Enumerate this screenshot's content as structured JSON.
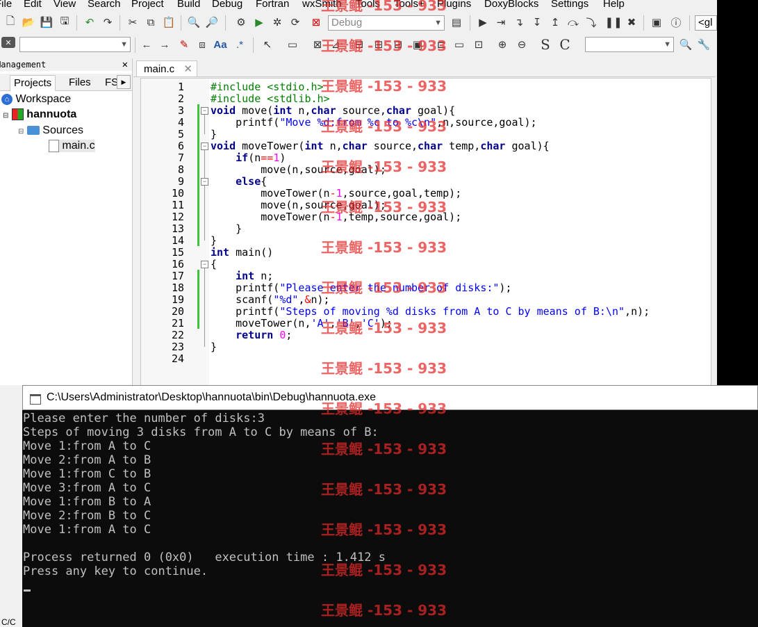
{
  "menu": [
    "File",
    "Edit",
    "View",
    "Search",
    "Project",
    "Build",
    "Debug",
    "Fortran",
    "wxSmith",
    "Tools",
    "Tools+",
    "Plugins",
    "DoxyBlocks",
    "Settings",
    "Help"
  ],
  "toolbar": {
    "build_target": "Debug",
    "right_combo": "<gl"
  },
  "management": {
    "title": "Management",
    "tabs": [
      "Projects",
      "Files",
      "FS"
    ],
    "workspace": "Workspace",
    "project": "hannuota",
    "folder": "Sources",
    "file": "main.c"
  },
  "editor": {
    "tab": "main.c",
    "lines": [
      {
        "n": "1",
        "html": "<span class='pp'>#include &lt;stdio.h&gt;</span>"
      },
      {
        "n": "2",
        "html": "<span class='pp'>#include &lt;stdlib.h&gt;</span>"
      },
      {
        "n": "3",
        "html": "<span class='kw'>void</span> move(<span class='kw'>int</span> n,<span class='kw'>char</span> source,<span class='kw'>char</span> goal){"
      },
      {
        "n": "4",
        "html": "    printf(<span class='st'>\"Move %d:from %c to %c\\n\"</span>,n,source,goal);"
      },
      {
        "n": "5",
        "html": "}"
      },
      {
        "n": "6",
        "html": "<span class='kw'>void</span> moveTower(<span class='kw'>int</span> n,<span class='kw'>char</span> source,<span class='kw'>char</span> temp,<span class='kw'>char</span> goal){"
      },
      {
        "n": "7",
        "html": "    <span class='kw'>if</span>(n<span class='op'>==</span><span class='nm'>1</span>)"
      },
      {
        "n": "8",
        "html": "        move(n,source,goal);"
      },
      {
        "n": "9",
        "html": "    <span class='kw'>else</span>{"
      },
      {
        "n": "10",
        "html": "        moveTower(n<span class='op'>-</span><span class='nm'>1</span>,source,goal,temp);"
      },
      {
        "n": "11",
        "html": "        move(n,source,goal);"
      },
      {
        "n": "12",
        "html": "        moveTower(n<span class='op'>-</span><span class='nm'>1</span>,temp,source,goal);"
      },
      {
        "n": "13",
        "html": "    }"
      },
      {
        "n": "14",
        "html": "}"
      },
      {
        "n": "15",
        "html": "<span class='kw'>int</span> main()"
      },
      {
        "n": "16",
        "html": "{"
      },
      {
        "n": "17",
        "html": "    <span class='kw'>int</span> n;"
      },
      {
        "n": "18",
        "html": "    printf(<span class='st'>\"Please enter the number of disks:\"</span>);"
      },
      {
        "n": "19",
        "html": "    scanf(<span class='st'>\"%d\"</span>,<span class='op'>&amp;</span>n);"
      },
      {
        "n": "20",
        "html": "    printf(<span class='st'>\"Steps of moving %d disks from A to C by means of B:\\n\"</span>,n);"
      },
      {
        "n": "21",
        "html": "    moveTower(n,<span class='st'>'A'</span>,<span class='st'>'B'</span>,<span class='st'>'C'</span>);"
      },
      {
        "n": "22",
        "html": "    <span class='kw'>return</span> <span class='nm'>0</span>;"
      },
      {
        "n": "23",
        "html": "}"
      },
      {
        "n": "24",
        "html": ""
      }
    ]
  },
  "console": {
    "title": "C:\\Users\\Administrator\\Desktop\\hannuota\\bin\\Debug\\hannuota.exe",
    "lines": [
      "Please enter the number of disks:3",
      "Steps of moving 3 disks from A to C by means of B:",
      "Move 1:from A to C",
      "Move 2:from A to B",
      "Move 1:from C to B",
      "Move 3:from A to C",
      "Move 1:from B to A",
      "Move 2:from B to C",
      "Move 1:from A to C",
      "",
      "Process returned 0 (0x0)   execution time : 1.412 s",
      "Press any key to continue."
    ]
  },
  "watermark": "王景鲲 -153 - 933",
  "status_fragment": "C/C"
}
